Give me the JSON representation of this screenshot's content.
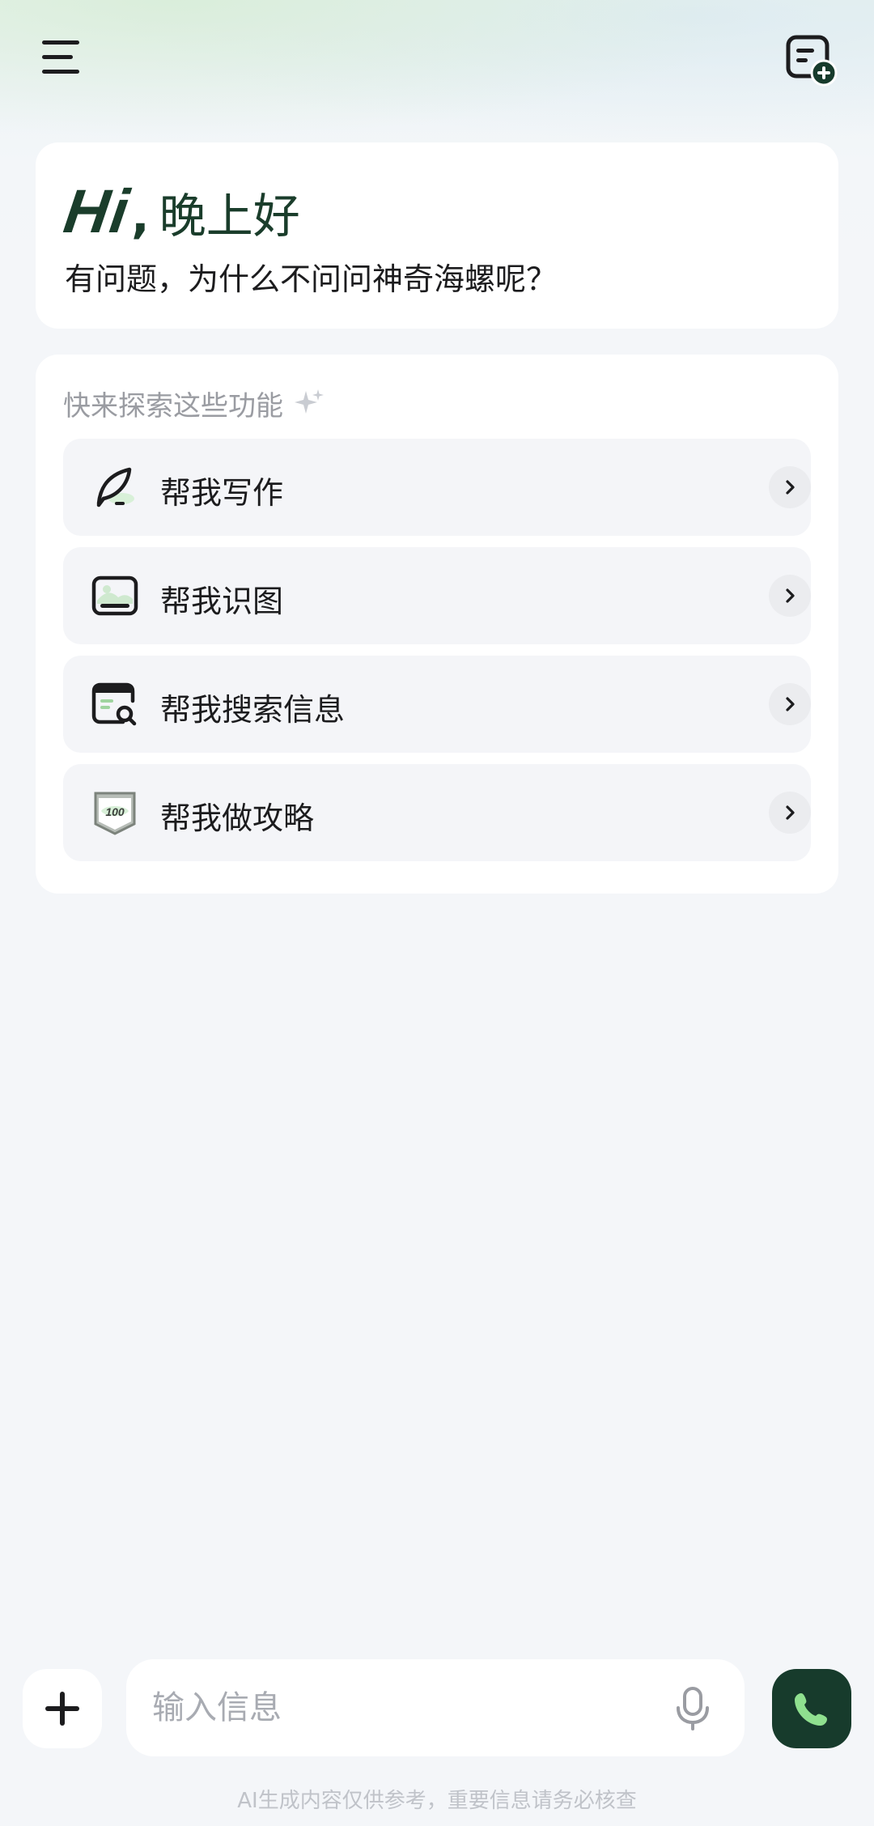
{
  "greeting": {
    "hi": "Hi",
    "comma": ",",
    "salutation": "晚上好",
    "subtitle": "有问题，为什么不问问神奇海螺呢？"
  },
  "features": {
    "title": "快来探索这些功能",
    "items": [
      {
        "label": "帮我写作",
        "icon": "quill-icon"
      },
      {
        "label": "帮我识图",
        "icon": "image-icon"
      },
      {
        "label": "帮我搜索信息",
        "icon": "search-document-icon"
      },
      {
        "label": "帮我做攻略",
        "icon": "badge-100-icon"
      }
    ]
  },
  "composer": {
    "placeholder": "输入信息"
  },
  "disclaimer": "AI生成内容仅供参考，重要信息请务必核查",
  "colors": {
    "brand_dark_green": "#173b2c",
    "accent_green": "#2e8b57",
    "background": "#f4f6f9"
  }
}
